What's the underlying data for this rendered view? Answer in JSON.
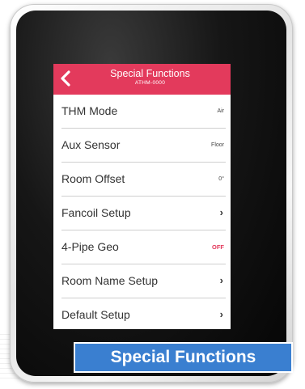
{
  "header": {
    "title": "Special Functions",
    "subtitle": "ATHM-0000"
  },
  "menu": [
    {
      "label": "THM  Mode",
      "value": "Air",
      "type": "value"
    },
    {
      "label": "Aux Sensor",
      "value": "Floor",
      "type": "value"
    },
    {
      "label": "Room Offset",
      "value": "0°",
      "type": "value"
    },
    {
      "label": "Fancoil Setup",
      "value": "›",
      "type": "chevron"
    },
    {
      "label": "4-Pipe Geo",
      "value": "OFF",
      "type": "toggle"
    },
    {
      "label": "Room Name Setup",
      "value": "›",
      "type": "chevron"
    },
    {
      "label": "Default Setup",
      "value": "›",
      "type": "chevron"
    }
  ],
  "caption": "Special Functions",
  "colors": {
    "accent": "#e33a5c",
    "caption_bg": "#3a7fd0"
  },
  "icons": {
    "back": "chevron-left-icon",
    "forward": "chevron-right-icon"
  }
}
